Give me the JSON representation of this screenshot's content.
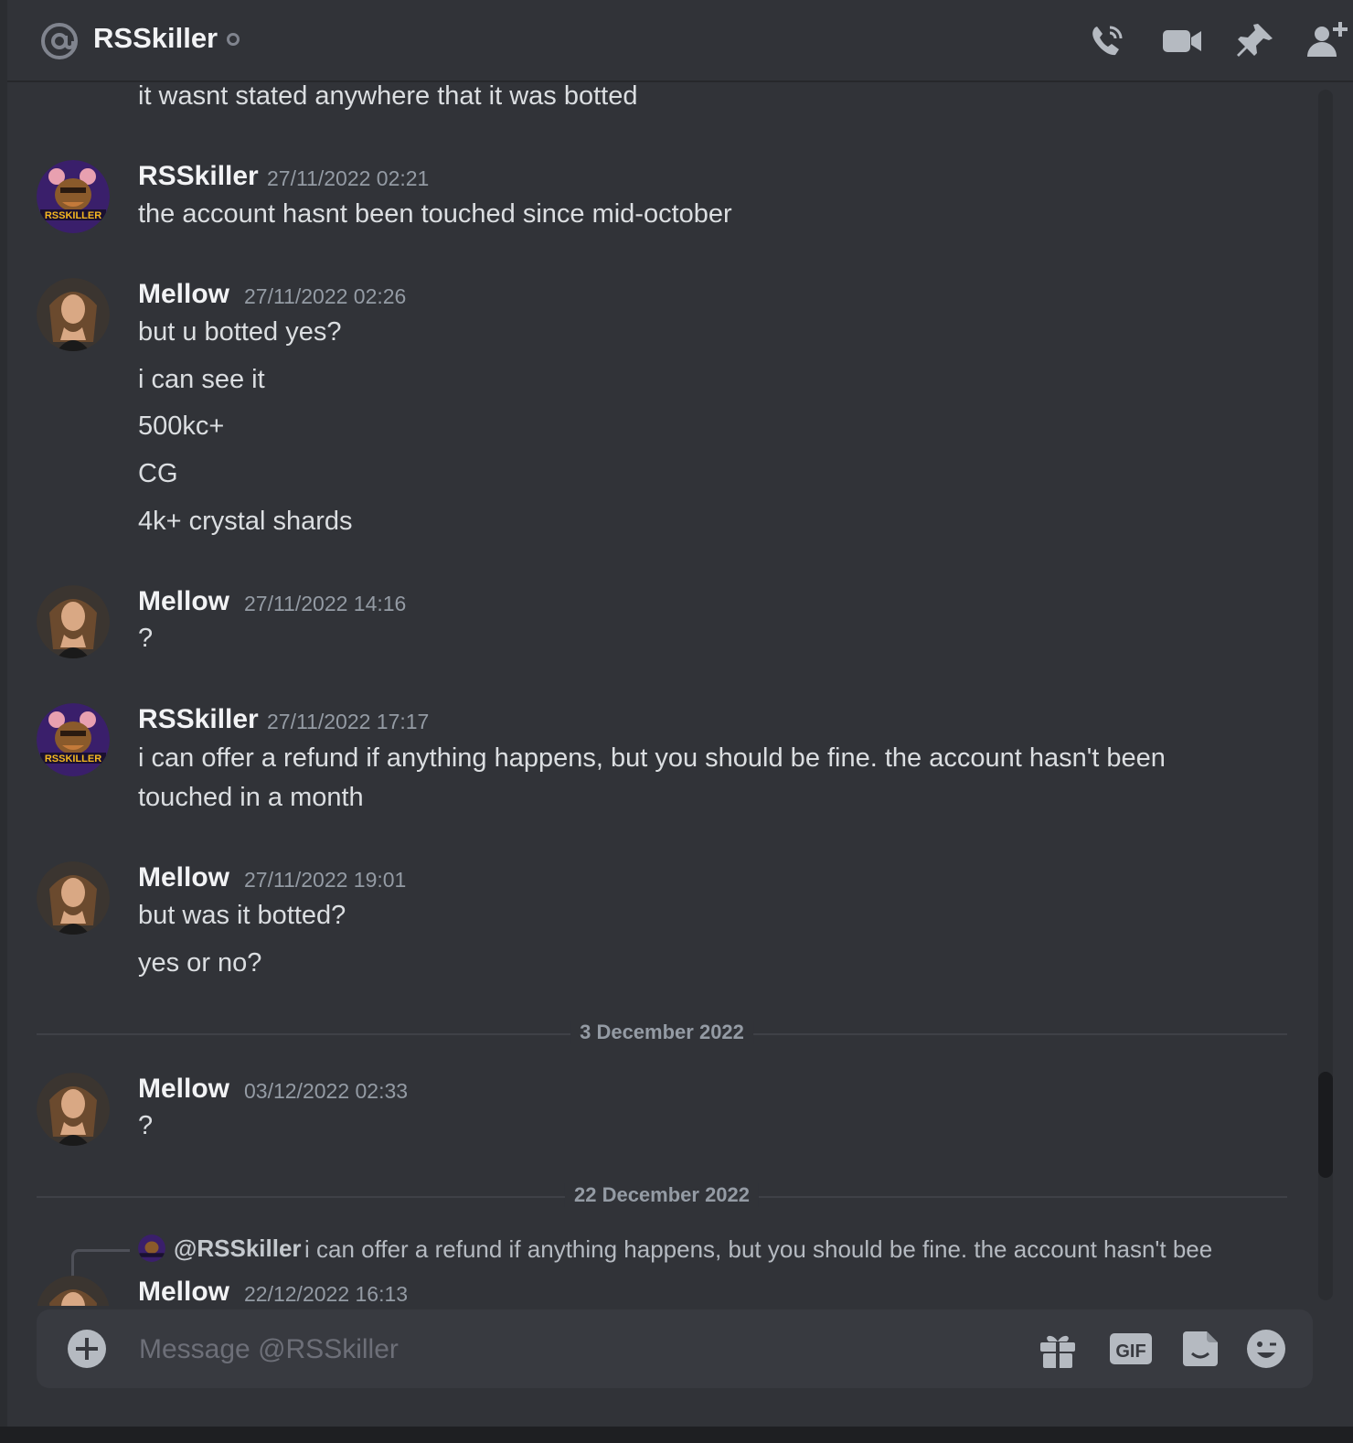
{
  "header": {
    "title": "RSSkiller",
    "icons": [
      "at-icon",
      "voice-call-icon",
      "video-call-icon",
      "pinned-messages-icon",
      "add-friends-icon"
    ]
  },
  "messages": {
    "continuation_text": "it wasnt stated anywhere that it was botted",
    "groups": [
      {
        "author": "RSSkiller",
        "timestamp": "27/11/2022 02:21",
        "lines": [
          "the account hasnt been touched since mid-october"
        ]
      },
      {
        "author": "Mellow",
        "timestamp": "27/11/2022 02:26",
        "lines": [
          "but u botted yes?",
          "i can see it",
          "500kc+",
          "CG",
          "4k+ crystal shards"
        ]
      },
      {
        "author": "Mellow",
        "timestamp": "27/11/2022 14:16",
        "lines": [
          "?"
        ]
      },
      {
        "author": "RSSkiller",
        "timestamp": "27/11/2022 17:17",
        "lines": [
          "i can offer a refund if anything happens, but you should be fine. the account hasn't been touched in a month"
        ]
      },
      {
        "author": "Mellow",
        "timestamp": "27/11/2022 19:01",
        "lines": [
          "but was it botted?",
          "yes or no?"
        ]
      },
      {
        "author": "Mellow",
        "timestamp": "03/12/2022 02:33",
        "lines": [
          "?"
        ]
      },
      {
        "author": "Mellow",
        "timestamp": "22/12/2022 16:13",
        "reply": {
          "mention": "@RSSkiller",
          "text": "i can offer a refund if anything happens, but you should be fine. the account hasn't bee"
        },
        "lines": []
      }
    ],
    "dividers": [
      "3 December 2022",
      "22 December 2022"
    ]
  },
  "composer": {
    "placeholder": "Message @RSSkiller",
    "value": "",
    "gif_label": "GIF",
    "icons": [
      "add-attachment-icon",
      "gift-icon",
      "gif-icon",
      "sticker-icon",
      "emoji-icon"
    ]
  },
  "colors": {
    "background": "#313338",
    "composer": "#383a40",
    "text": "#dbdee1",
    "muted": "#949ba4",
    "username": "#f2f3f5",
    "rsskiller_avatar_bg": "#3a1f6b"
  }
}
